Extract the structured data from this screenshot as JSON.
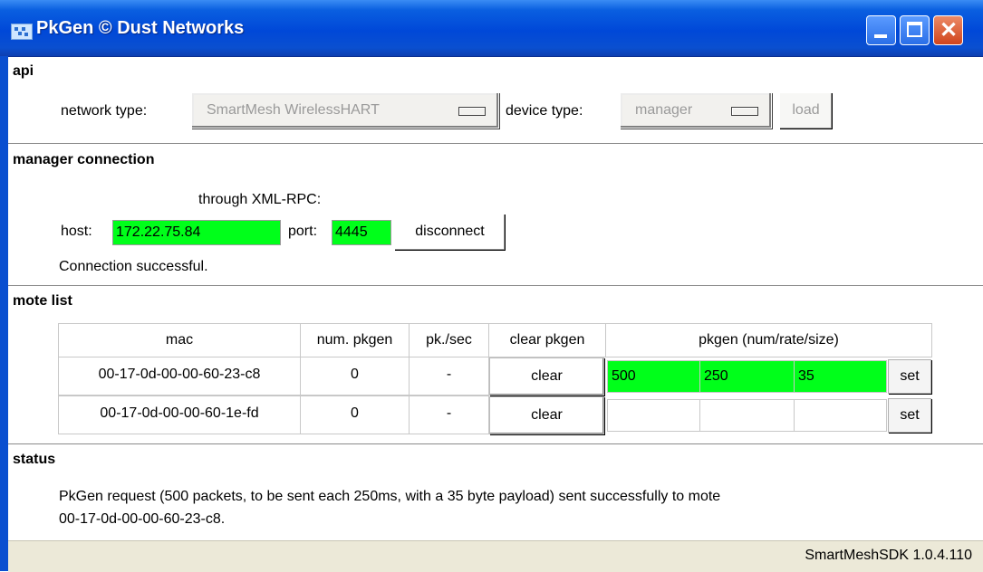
{
  "window": {
    "title": "PkGen © Dust Networks",
    "title_bar_color": "#0054e3",
    "close_button_color": "#e0552c"
  },
  "api": {
    "section_title": "api",
    "network_type_label": "network type:",
    "network_type_value": "SmartMesh WirelessHART",
    "device_type_label": "device type:",
    "device_type_value": "manager",
    "load_label": "load"
  },
  "manager_connection": {
    "section_title": "manager connection",
    "through_label": "through XML-RPC:",
    "host_label": "host:",
    "host_value": "172.22.75.84",
    "port_label": "port:",
    "port_value": "4445",
    "disconnect_label": "disconnect",
    "message": "Connection successful.",
    "field_color": "#00ff1a"
  },
  "mote_list": {
    "section_title": "mote list",
    "headers": [
      "mac",
      "num. pkgen",
      "pk./sec",
      "clear pkgen",
      "pkgen (num/rate/size)"
    ],
    "rows": [
      {
        "mac": "00-17-0d-00-00-60-23-c8",
        "num_pkgen": "0",
        "pk_sec": "-",
        "clear_label": "clear",
        "pkgen_num": "500",
        "pkgen_rate": "250",
        "pkgen_size": "35",
        "set_label": "set"
      },
      {
        "mac": "00-17-0d-00-00-60-1e-fd",
        "num_pkgen": "0",
        "pk_sec": "-",
        "clear_label": "clear",
        "pkgen_num": "",
        "pkgen_rate": "",
        "pkgen_size": "",
        "set_label": "set"
      }
    ]
  },
  "status": {
    "section_title": "status",
    "line1": "PkGen request (500 packets, to be sent each 250ms, with a 35 byte payload) sent successfully to mote",
    "line2": "00-17-0d-00-00-60-23-c8."
  },
  "statusbar": {
    "version": "SmartMeshSDK 1.0.4.110"
  }
}
